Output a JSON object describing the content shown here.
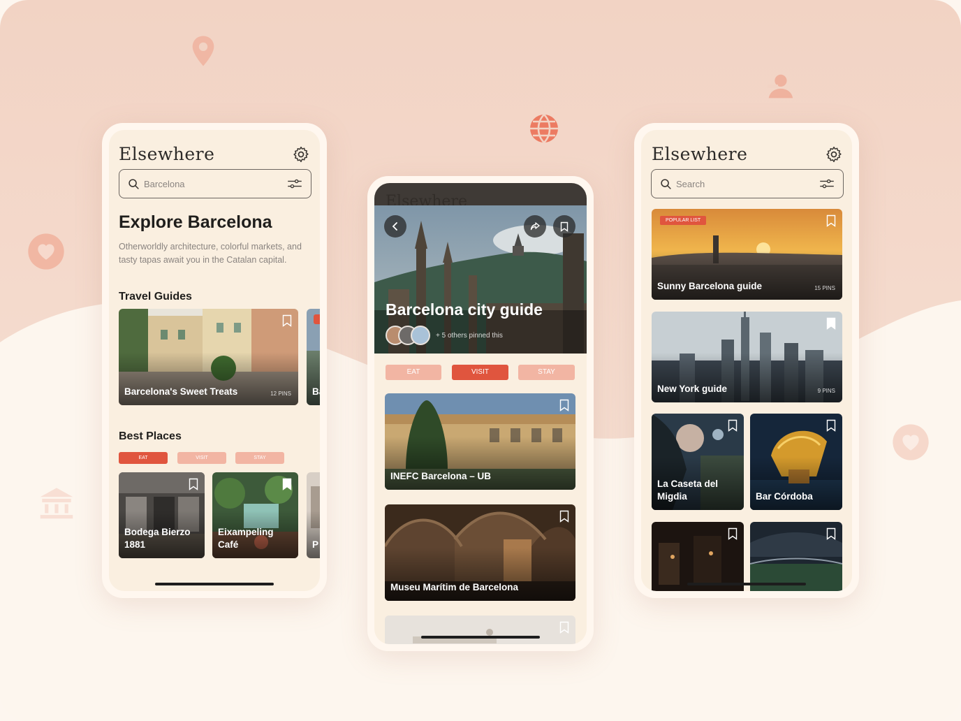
{
  "colors": {
    "accent": "#e0553e",
    "accent_light": "#f2b5a3",
    "cream": "#faefe0",
    "pink_bg": "#f3d6c8"
  },
  "left_phone": {
    "brand": "Elsewhere",
    "search": {
      "value": "Barcelona"
    },
    "heading": "Explore Barcelona",
    "description": "Otherworldly architecture, colorful markets, and tasty tapas await you in the Catalan capital.",
    "travel_guides_label": "Travel Guides",
    "guides": [
      {
        "title": "Barcelona's Sweet Treats",
        "meta": "12 PINS"
      },
      {
        "title": "Ba"
      }
    ],
    "best_places_label": "Best Places",
    "tabs": [
      "EAT",
      "VISIT",
      "STAY"
    ],
    "places": [
      {
        "title": "Bodega Bierzo 1881"
      },
      {
        "title": "Eixampeling Café"
      },
      {
        "title": "P"
      }
    ]
  },
  "center_phone": {
    "header_text": "Elsewhere",
    "title": "Barcelona city guide",
    "pinned_text": "+ 5 others pinned this",
    "tabs": [
      "EAT",
      "VISIT",
      "STAY"
    ],
    "places": [
      {
        "title": "INEFC Barcelona – UB"
      },
      {
        "title": "Museu Marítim de Barcelona"
      },
      {
        "title": ""
      }
    ]
  },
  "right_phone": {
    "brand": "Elsewhere",
    "search": {
      "placeholder": "Search"
    },
    "popular_badge": "POPULAR LIST",
    "guides": [
      {
        "title": "Sunny Barcelona guide",
        "meta": "15 PINS"
      },
      {
        "title": "New York guide",
        "meta": "9 PINS"
      }
    ],
    "places": [
      {
        "title": "La Caseta del Migdia"
      },
      {
        "title": "Bar Córdoba"
      },
      {
        "title": ""
      },
      {
        "title": ""
      }
    ]
  }
}
